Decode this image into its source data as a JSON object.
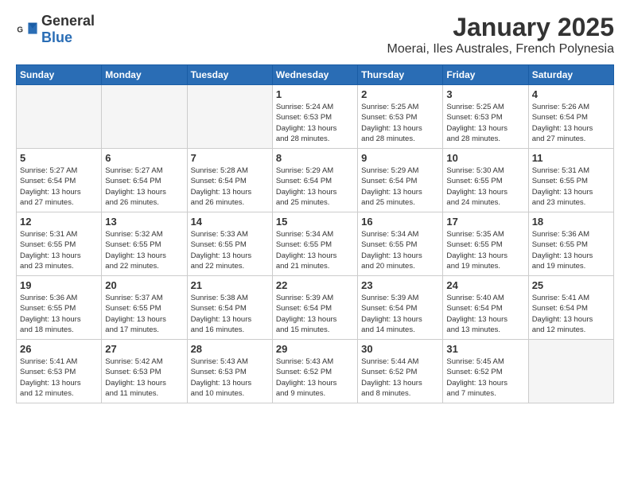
{
  "header": {
    "logo_general": "General",
    "logo_blue": "Blue",
    "month": "January 2025",
    "location": "Moerai, Iles Australes, French Polynesia"
  },
  "days_of_week": [
    "Sunday",
    "Monday",
    "Tuesday",
    "Wednesday",
    "Thursday",
    "Friday",
    "Saturday"
  ],
  "weeks": [
    [
      {
        "day": "",
        "empty": true
      },
      {
        "day": "",
        "empty": true
      },
      {
        "day": "",
        "empty": true
      },
      {
        "day": "1",
        "info": "Sunrise: 5:24 AM\nSunset: 6:53 PM\nDaylight: 13 hours\nand 28 minutes."
      },
      {
        "day": "2",
        "info": "Sunrise: 5:25 AM\nSunset: 6:53 PM\nDaylight: 13 hours\nand 28 minutes."
      },
      {
        "day": "3",
        "info": "Sunrise: 5:25 AM\nSunset: 6:53 PM\nDaylight: 13 hours\nand 28 minutes."
      },
      {
        "day": "4",
        "info": "Sunrise: 5:26 AM\nSunset: 6:54 PM\nDaylight: 13 hours\nand 27 minutes."
      }
    ],
    [
      {
        "day": "5",
        "info": "Sunrise: 5:27 AM\nSunset: 6:54 PM\nDaylight: 13 hours\nand 27 minutes."
      },
      {
        "day": "6",
        "info": "Sunrise: 5:27 AM\nSunset: 6:54 PM\nDaylight: 13 hours\nand 26 minutes."
      },
      {
        "day": "7",
        "info": "Sunrise: 5:28 AM\nSunset: 6:54 PM\nDaylight: 13 hours\nand 26 minutes."
      },
      {
        "day": "8",
        "info": "Sunrise: 5:29 AM\nSunset: 6:54 PM\nDaylight: 13 hours\nand 25 minutes."
      },
      {
        "day": "9",
        "info": "Sunrise: 5:29 AM\nSunset: 6:54 PM\nDaylight: 13 hours\nand 25 minutes."
      },
      {
        "day": "10",
        "info": "Sunrise: 5:30 AM\nSunset: 6:55 PM\nDaylight: 13 hours\nand 24 minutes."
      },
      {
        "day": "11",
        "info": "Sunrise: 5:31 AM\nSunset: 6:55 PM\nDaylight: 13 hours\nand 23 minutes."
      }
    ],
    [
      {
        "day": "12",
        "info": "Sunrise: 5:31 AM\nSunset: 6:55 PM\nDaylight: 13 hours\nand 23 minutes."
      },
      {
        "day": "13",
        "info": "Sunrise: 5:32 AM\nSunset: 6:55 PM\nDaylight: 13 hours\nand 22 minutes."
      },
      {
        "day": "14",
        "info": "Sunrise: 5:33 AM\nSunset: 6:55 PM\nDaylight: 13 hours\nand 22 minutes."
      },
      {
        "day": "15",
        "info": "Sunrise: 5:34 AM\nSunset: 6:55 PM\nDaylight: 13 hours\nand 21 minutes."
      },
      {
        "day": "16",
        "info": "Sunrise: 5:34 AM\nSunset: 6:55 PM\nDaylight: 13 hours\nand 20 minutes."
      },
      {
        "day": "17",
        "info": "Sunrise: 5:35 AM\nSunset: 6:55 PM\nDaylight: 13 hours\nand 19 minutes."
      },
      {
        "day": "18",
        "info": "Sunrise: 5:36 AM\nSunset: 6:55 PM\nDaylight: 13 hours\nand 19 minutes."
      }
    ],
    [
      {
        "day": "19",
        "info": "Sunrise: 5:36 AM\nSunset: 6:55 PM\nDaylight: 13 hours\nand 18 minutes."
      },
      {
        "day": "20",
        "info": "Sunrise: 5:37 AM\nSunset: 6:55 PM\nDaylight: 13 hours\nand 17 minutes."
      },
      {
        "day": "21",
        "info": "Sunrise: 5:38 AM\nSunset: 6:54 PM\nDaylight: 13 hours\nand 16 minutes."
      },
      {
        "day": "22",
        "info": "Sunrise: 5:39 AM\nSunset: 6:54 PM\nDaylight: 13 hours\nand 15 minutes."
      },
      {
        "day": "23",
        "info": "Sunrise: 5:39 AM\nSunset: 6:54 PM\nDaylight: 13 hours\nand 14 minutes."
      },
      {
        "day": "24",
        "info": "Sunrise: 5:40 AM\nSunset: 6:54 PM\nDaylight: 13 hours\nand 13 minutes."
      },
      {
        "day": "25",
        "info": "Sunrise: 5:41 AM\nSunset: 6:54 PM\nDaylight: 13 hours\nand 12 minutes."
      }
    ],
    [
      {
        "day": "26",
        "info": "Sunrise: 5:41 AM\nSunset: 6:53 PM\nDaylight: 13 hours\nand 12 minutes."
      },
      {
        "day": "27",
        "info": "Sunrise: 5:42 AM\nSunset: 6:53 PM\nDaylight: 13 hours\nand 11 minutes."
      },
      {
        "day": "28",
        "info": "Sunrise: 5:43 AM\nSunset: 6:53 PM\nDaylight: 13 hours\nand 10 minutes."
      },
      {
        "day": "29",
        "info": "Sunrise: 5:43 AM\nSunset: 6:52 PM\nDaylight: 13 hours\nand 9 minutes."
      },
      {
        "day": "30",
        "info": "Sunrise: 5:44 AM\nSunset: 6:52 PM\nDaylight: 13 hours\nand 8 minutes."
      },
      {
        "day": "31",
        "info": "Sunrise: 5:45 AM\nSunset: 6:52 PM\nDaylight: 13 hours\nand 7 minutes."
      },
      {
        "day": "",
        "empty": true
      }
    ]
  ]
}
